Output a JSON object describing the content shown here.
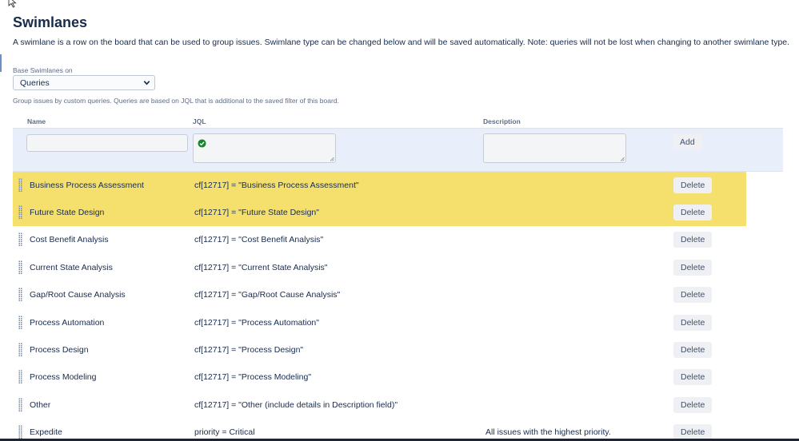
{
  "page": {
    "title": "Swimlanes",
    "intro": "A swimlane is a row on the board that can be used to group issues. Swimlane type can be changed below and will be saved automatically. Note: queries will not be lost when changing to another swimlane type."
  },
  "base": {
    "label": "Base Swimlanes on",
    "selected": "Queries",
    "help": "Group issues by custom queries. Queries are based on JQL that is additional to the saved filter of this board."
  },
  "table": {
    "headers": {
      "name": "Name",
      "jql": "JQL",
      "description": "Description"
    },
    "add_label": "Add",
    "delete_label": "Delete",
    "rows": [
      {
        "name": "Business Process Assessment",
        "jql": "cf[12717] = \"Business Process Assessment\"",
        "description": "",
        "highlighted": true
      },
      {
        "name": "Future State Design",
        "jql": "cf[12717] = \"Future State Design\"",
        "description": "",
        "highlighted": true
      },
      {
        "name": "Cost Benefit Analysis",
        "jql": "cf[12717] = \"Cost Benefit Analysis\"",
        "description": "",
        "highlighted": false
      },
      {
        "name": "Current State Analysis",
        "jql": "cf[12717] = \"Current State Analysis\"",
        "description": "",
        "highlighted": false
      },
      {
        "name": "Gap/Root Cause Analysis",
        "jql": "cf[12717] = \"Gap/Root Cause Analysis\"",
        "description": "",
        "highlighted": false
      },
      {
        "name": "Process Automation",
        "jql": "cf[12717] = \"Process Automation\"",
        "description": "",
        "highlighted": false
      },
      {
        "name": "Process Design",
        "jql": "cf[12717] = \"Process Design\"",
        "description": "",
        "highlighted": false
      },
      {
        "name": "Process Modeling",
        "jql": "cf[12717] = \"Process Modeling\"",
        "description": "",
        "highlighted": false
      },
      {
        "name": "Other",
        "jql": "cf[12717] = \"Other (include details in Description field)\"",
        "description": "",
        "highlighted": false
      },
      {
        "name": "Expedite",
        "jql": "priority = Critical",
        "description": "All issues with the highest priority.",
        "highlighted": false
      }
    ]
  },
  "colors": {
    "highlight": "#f5e06e",
    "add_band": "#e9effa",
    "valid": "#14892c"
  },
  "icons": {
    "cursor": "mouse-pointer-icon",
    "select": "chevron-down-icon",
    "valid": "check-circle-icon",
    "resize": "resize-handle-icon",
    "drag": "drag-handle-icon"
  }
}
